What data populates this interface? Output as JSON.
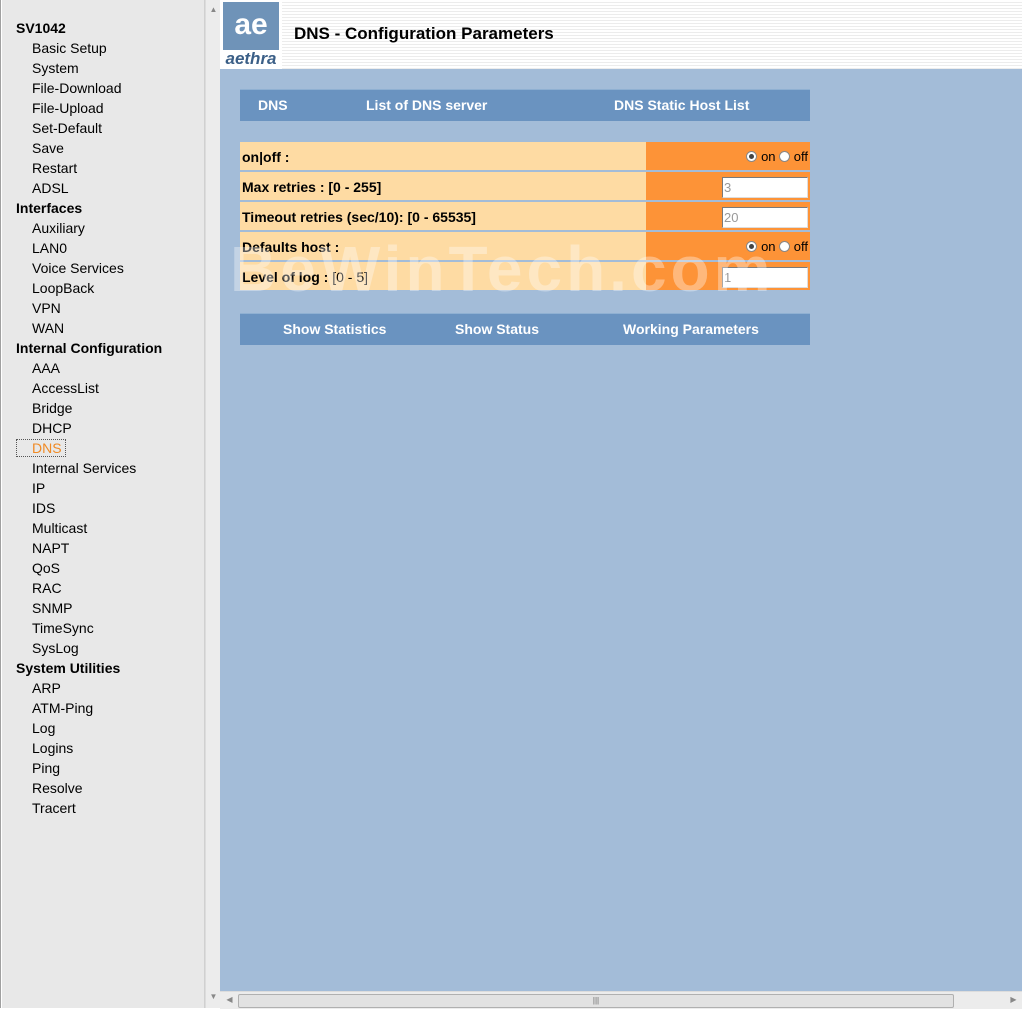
{
  "sidebar": {
    "items": [
      {
        "label": "SV1042",
        "kind": "section"
      },
      {
        "label": "Basic Setup",
        "kind": "item"
      },
      {
        "label": "System",
        "kind": "item"
      },
      {
        "label": "File-Download",
        "kind": "item"
      },
      {
        "label": "File-Upload",
        "kind": "item"
      },
      {
        "label": "Set-Default",
        "kind": "item"
      },
      {
        "label": "Save",
        "kind": "item"
      },
      {
        "label": "Restart",
        "kind": "item"
      },
      {
        "label": "ADSL",
        "kind": "item"
      },
      {
        "label": "Interfaces",
        "kind": "section"
      },
      {
        "label": "Auxiliary",
        "kind": "item"
      },
      {
        "label": "LAN0",
        "kind": "item"
      },
      {
        "label": "Voice Services",
        "kind": "item"
      },
      {
        "label": "LoopBack",
        "kind": "item"
      },
      {
        "label": "VPN",
        "kind": "item"
      },
      {
        "label": "WAN",
        "kind": "item"
      },
      {
        "label": "Internal Configuration",
        "kind": "section"
      },
      {
        "label": "AAA",
        "kind": "item"
      },
      {
        "label": "AccessList",
        "kind": "item"
      },
      {
        "label": "Bridge",
        "kind": "item"
      },
      {
        "label": "DHCP",
        "kind": "item"
      },
      {
        "label": "DNS",
        "kind": "item",
        "active": true
      },
      {
        "label": "Internal Services",
        "kind": "item"
      },
      {
        "label": "IP",
        "kind": "item"
      },
      {
        "label": "IDS",
        "kind": "item"
      },
      {
        "label": "Multicast",
        "kind": "item"
      },
      {
        "label": "NAPT",
        "kind": "item"
      },
      {
        "label": "QoS",
        "kind": "item"
      },
      {
        "label": "RAC",
        "kind": "item"
      },
      {
        "label": "SNMP",
        "kind": "item"
      },
      {
        "label": "TimeSync",
        "kind": "item"
      },
      {
        "label": "SysLog",
        "kind": "item"
      },
      {
        "label": "System Utilities",
        "kind": "section"
      },
      {
        "label": "ARP",
        "kind": "item"
      },
      {
        "label": "ATM-Ping",
        "kind": "item"
      },
      {
        "label": "Log",
        "kind": "item"
      },
      {
        "label": "Logins",
        "kind": "item"
      },
      {
        "label": "Ping",
        "kind": "item"
      },
      {
        "label": "Resolve",
        "kind": "item"
      },
      {
        "label": "Tracert",
        "kind": "item"
      }
    ]
  },
  "logo": {
    "mark": "ae",
    "text": "aethra"
  },
  "header": {
    "title": "DNS - Configuration Parameters"
  },
  "top_tabs": {
    "dns": "DNS",
    "dns_servers": "List of DNS server",
    "static_hosts": "DNS Static Host List"
  },
  "form": {
    "onoff": {
      "label": "on|off :",
      "on": "on",
      "off": "off",
      "selected": "on"
    },
    "max_retries": {
      "label": "Max retries : ",
      "range": "[0 - 255]",
      "value": "3"
    },
    "timeout": {
      "label": "Timeout retries (sec/10): ",
      "range": "[0 - 65535]",
      "value": "20"
    },
    "defaults_host": {
      "label": "Defaults host :",
      "on": "on",
      "off": "off",
      "selected": "on"
    },
    "log_level": {
      "label": "Level of log : ",
      "range": "[0 - 5]",
      "value": "1"
    }
  },
  "bottom_tabs": {
    "statistics": "Show Statistics",
    "status": "Show Status",
    "working": "Working Parameters"
  },
  "watermark": "BeWinTech.com",
  "colors": {
    "accent_orange": "#fd9337",
    "label_bg": "#fedba3",
    "tab_blue": "#6a93c0",
    "page_bg": "#a3bcd8"
  }
}
